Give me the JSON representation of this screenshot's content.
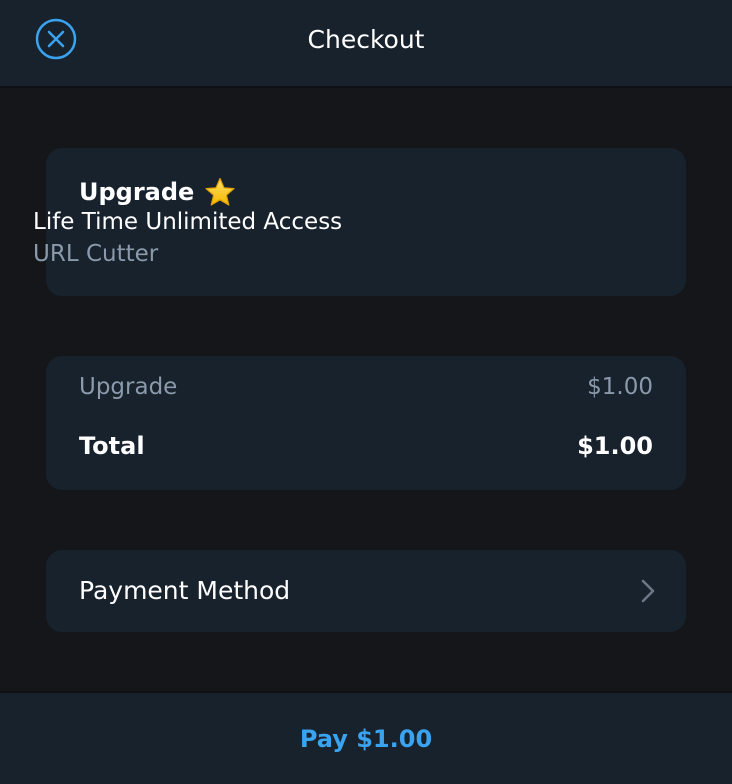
{
  "header": {
    "title": "Checkout",
    "close_icon": "close-circle-icon"
  },
  "product": {
    "title": "Upgrade",
    "title_icon": "star-icon",
    "description": "Life Time Unlimited Access",
    "app_name": "URL Cutter"
  },
  "summary": {
    "item_label": "Upgrade",
    "item_price": "$1.00",
    "total_label": "Total",
    "total_price": "$1.00"
  },
  "payment": {
    "label": "Payment Method",
    "chevron_icon": "chevron-right-icon"
  },
  "footer": {
    "pay_label": "Pay $1.00"
  },
  "colors": {
    "background": "#151619",
    "card": "#18222d",
    "accent": "#3aa3f0",
    "secondary_text": "#8a9aab"
  }
}
